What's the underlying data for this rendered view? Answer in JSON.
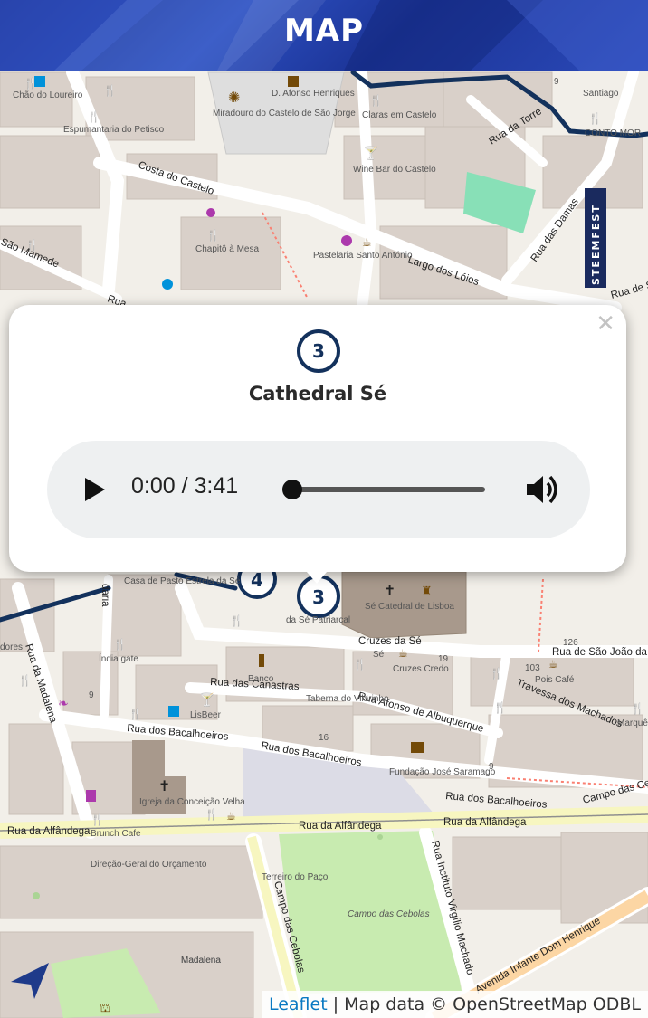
{
  "header": {
    "title": "MAP"
  },
  "popup": {
    "stop_number": "3",
    "stop_name": "Cathedral Sé",
    "close_symbol": "✕",
    "player": {
      "time": "0:00 / 3:41",
      "progress": 0.0
    }
  },
  "attribution": {
    "leaflet": "Leaflet",
    "separator": "|",
    "map_data": "Map data © OpenStreetMap ODBL"
  },
  "map": {
    "route_markers": [
      "4",
      "3"
    ],
    "steemfest_label": "STEEMFEST",
    "roads": [
      "Costa do Castelo",
      "Largo dos Lóios",
      "Rua da Torre",
      "Rua das Damas",
      "Rua de Santiago",
      "São Mamede",
      "Rua",
      "Cruzes da Sé",
      "Rua de São João da P",
      "Rua das Canastras",
      "Rua Afonso de Albuquerque",
      "Travessa dos Machados",
      "Rua dos Bacalhoeiros",
      "Rua dos Bacalhoeiros",
      "Rua dos Bacalhoeiros",
      "Campo das Cebolas",
      "Rua da Alfândega",
      "Rua da Alfândega",
      "Rua da Alfândega",
      "Rua Instituto Virgílio Machado",
      "Rua da Madalena",
      "Campo das Cebolas",
      "Avenida Infante Dom Henrique",
      "Madalena",
      "daria"
    ],
    "places": [
      "Chão do Loureiro",
      "Espumantaria do Petisco",
      "Miradouro do Castelo de São Jorge",
      "D. Afonso Henriques",
      "Claras em Castelo",
      "Wine Bar do Castelo",
      "Santiago",
      "Chapitô à Mesa",
      "Pastelaria Santo António",
      "CONTO MOR",
      "Casa de Pasto Estrela da Sé",
      "Sé Catedral de Lisboa",
      "da Sé Patriarcal",
      "Índia gate",
      "Banco",
      "LisBeer",
      "Taberna do Vilarinho",
      "Cruzes Credo",
      "Pois Café",
      "Fundação José Saramago",
      "Marquês da Sé",
      "Igreja da Conceição Velha",
      "Brunch Cafe",
      "Direção-Geral do Orçamento",
      "Terreiro do Paço",
      "Campo das Cebolas",
      "Madalena",
      "dores",
      "Sé"
    ],
    "house_numbers": [
      "9",
      "126",
      "103",
      "19",
      "16",
      "9",
      "9"
    ]
  }
}
